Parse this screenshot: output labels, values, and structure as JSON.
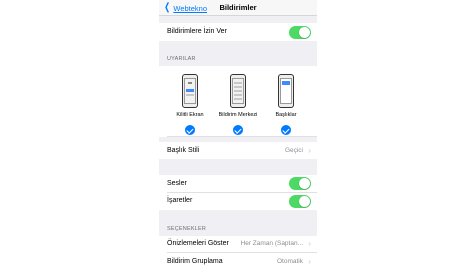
{
  "navbar": {
    "back_label": "Webtekno",
    "title": "Bildirimler"
  },
  "allow": {
    "label": "Bildirimlere İzin Ver",
    "on": true
  },
  "alerts": {
    "header": "UYARILAR",
    "options": [
      {
        "label": "Kilitli Ekran",
        "checked": true
      },
      {
        "label": "Bildirim Merkezi",
        "checked": true
      },
      {
        "label": "Başlıklar",
        "checked": true
      }
    ]
  },
  "banner_style": {
    "label": "Başlık Stili",
    "value": "Geçici"
  },
  "sounds": {
    "label": "Sesler",
    "on": true
  },
  "badges": {
    "label": "İşaretler",
    "on": true
  },
  "options_section": {
    "header": "SEÇENEKLER"
  },
  "show_previews": {
    "label": "Önizlemeleri Göster",
    "value": "Her Zaman (Saptan..."
  },
  "grouping": {
    "label": "Bildirim Gruplama",
    "value": "Otomatik"
  },
  "colors": {
    "accent": "#007aff",
    "toggle_on": "#4cd964",
    "background": "#efeff4"
  }
}
